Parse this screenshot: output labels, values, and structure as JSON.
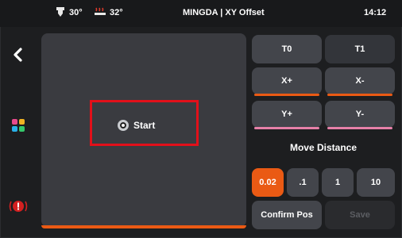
{
  "status_bar": {
    "nozzle_temp": "30°",
    "bed_temp": "32°",
    "title": "MINGDA | XY Offset",
    "time": "14:12"
  },
  "sidebar": {
    "icons": [
      "back-icon",
      "apps-icon",
      "alarm-icon"
    ]
  },
  "main": {
    "start_label": "Start"
  },
  "controls": {
    "tools": [
      "T0",
      "T1"
    ],
    "x_buttons": [
      "X+",
      "X-"
    ],
    "y_buttons": [
      "Y+",
      "Y-"
    ],
    "move_distance_label": "Move Distance",
    "distances": [
      ".02",
      ".1",
      "1",
      "10"
    ],
    "distance_display": [
      "0.02",
      ".1",
      "1",
      "10"
    ],
    "selected_distance": "0.02",
    "confirm_label": "Confirm Pos",
    "save_label": "Save"
  },
  "colors": {
    "accent_orange": "#ea5a14",
    "accent_pink": "#e680a8",
    "highlight_red": "#e2101a",
    "panel_gray": "#3a3b40",
    "background": "#1d1e20"
  }
}
